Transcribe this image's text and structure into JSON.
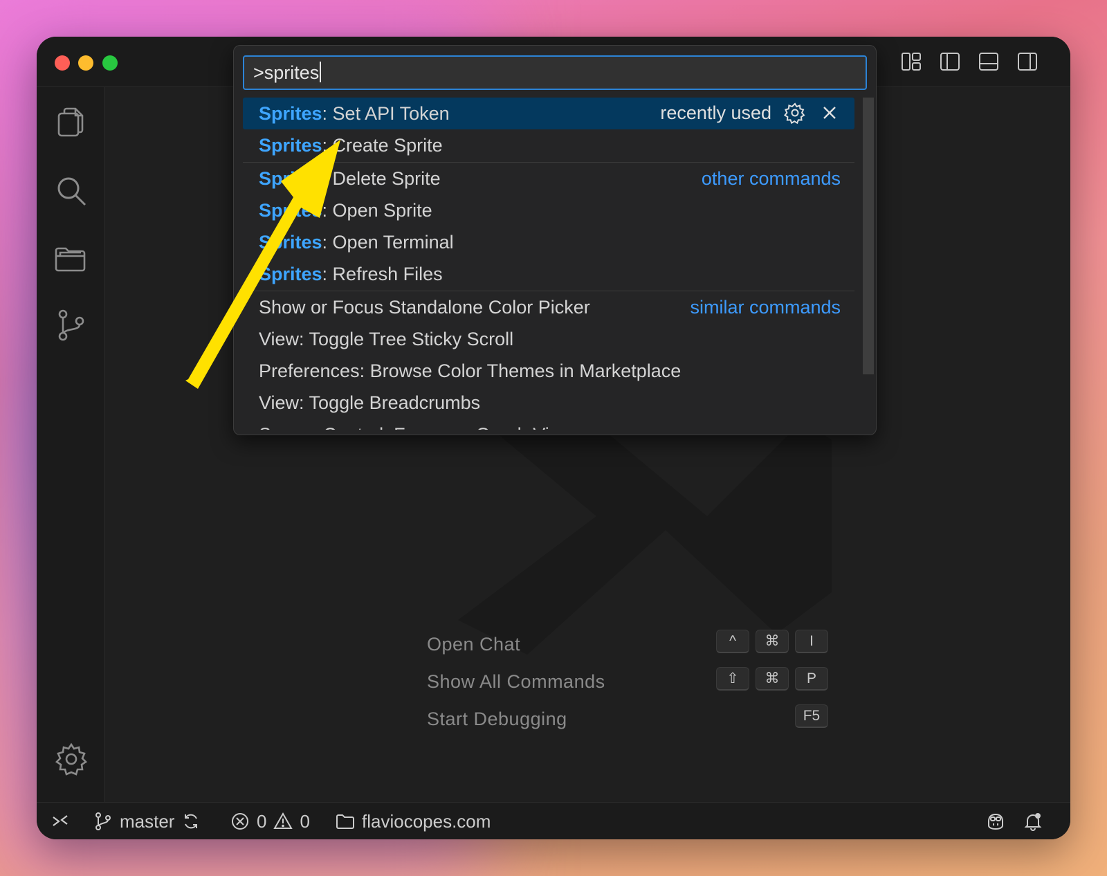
{
  "palette": {
    "input_value": ">sprites",
    "items": [
      {
        "prefix": "Sprites",
        "rest": ": Set API Token",
        "right": "recently used"
      },
      {
        "prefix": "Sprites",
        "rest": ": Create Sprite"
      },
      {
        "prefix": "Sprites",
        "rest": ": Delete Sprite",
        "right": "other commands"
      },
      {
        "prefix": "Sprites",
        "rest": ": Open Sprite"
      },
      {
        "prefix": "Sprites",
        "rest": ": Open Terminal"
      },
      {
        "prefix": "Sprites",
        "rest": ": Refresh Files"
      },
      {
        "text": "Show or Focus Standalone Color Picker",
        "right": "similar commands"
      },
      {
        "text": "View: Toggle Tree Sticky Scroll"
      },
      {
        "text": "Preferences: Browse Color Themes in Marketplace"
      },
      {
        "text": "View: Toggle Breadcrumbs"
      },
      {
        "text": "Source Control: Focus on Graph View"
      }
    ]
  },
  "shortcuts": [
    {
      "label": "Open Chat",
      "keys": [
        "^",
        "⌘",
        "I"
      ]
    },
    {
      "label": "Show All Commands",
      "keys": [
        "⇧",
        "⌘",
        "P"
      ]
    },
    {
      "label": "Start Debugging",
      "keys": [
        "F5"
      ]
    }
  ],
  "status": {
    "branch": "master",
    "errors": "0",
    "warnings": "0",
    "folder": "flaviocopes.com"
  },
  "colors": {
    "highlight": "#3ea5ff",
    "selection": "#04395e",
    "focus_border": "#2c83d6",
    "annotation_arrow": "#ffe100"
  }
}
